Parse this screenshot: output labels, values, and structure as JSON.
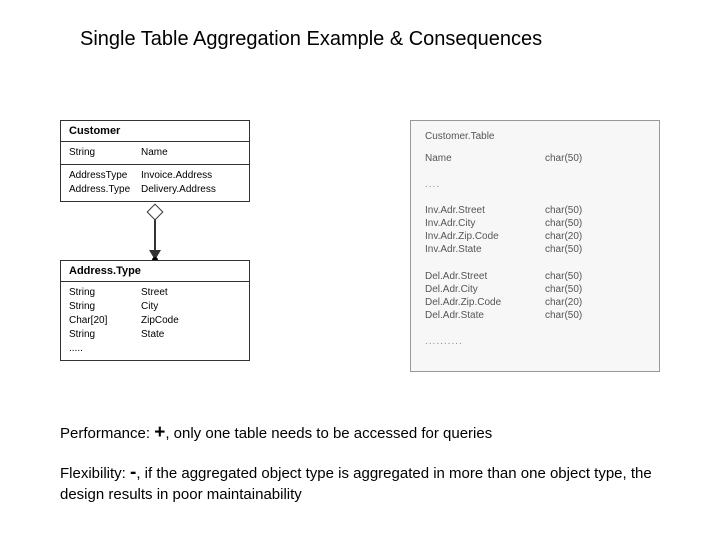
{
  "title": "Single Table Aggregation Example & Consequences",
  "uml": {
    "customer": {
      "title": "Customer",
      "section1": [
        {
          "type": "String",
          "name": "Name"
        }
      ],
      "section2": [
        {
          "type": "AddressType",
          "name": "Invoice.Address"
        },
        {
          "type": "Address.Type",
          "name": "Delivery.Address"
        }
      ]
    },
    "addresstype": {
      "title": "Address.Type",
      "section1": [
        {
          "type": "String",
          "name": "Street"
        },
        {
          "type": "String",
          "name": "City"
        },
        {
          "type": "Char[20]",
          "name": "ZipCode"
        },
        {
          "type": "String",
          "name": "State"
        }
      ],
      "ellipsis": "....."
    }
  },
  "table": {
    "title": "Customer.Table",
    "rows1": [
      {
        "name": "Name",
        "type": "char(50)"
      }
    ],
    "gap1": "....",
    "rows2": [
      {
        "name": "Inv.Adr.Street",
        "type": "char(50)"
      },
      {
        "name": "Inv.Adr.City",
        "type": "char(50)"
      },
      {
        "name": "Inv.Adr.Zip.Code",
        "type": "char(20)"
      },
      {
        "name": "Inv.Adr.State",
        "type": "char(50)"
      }
    ],
    "rows3": [
      {
        "name": "Del.Adr.Street",
        "type": "char(50)"
      },
      {
        "name": "Del.Adr.City",
        "type": "char(50)"
      },
      {
        "name": "Del.Adr.Zip.Code",
        "type": "char(20)"
      },
      {
        "name": "Del.Adr.State",
        "type": "char(50)"
      }
    ],
    "gap2": ".........."
  },
  "notes": {
    "perf_label": "Performance: ",
    "perf_sign": "+",
    "perf_text": ", only one table needs to be accessed for queries",
    "flex_label": "Flexibility: ",
    "flex_sign": "-",
    "flex_text": ", if the aggregated object type is aggregated in more than one object type, the design results in poor maintainability"
  }
}
